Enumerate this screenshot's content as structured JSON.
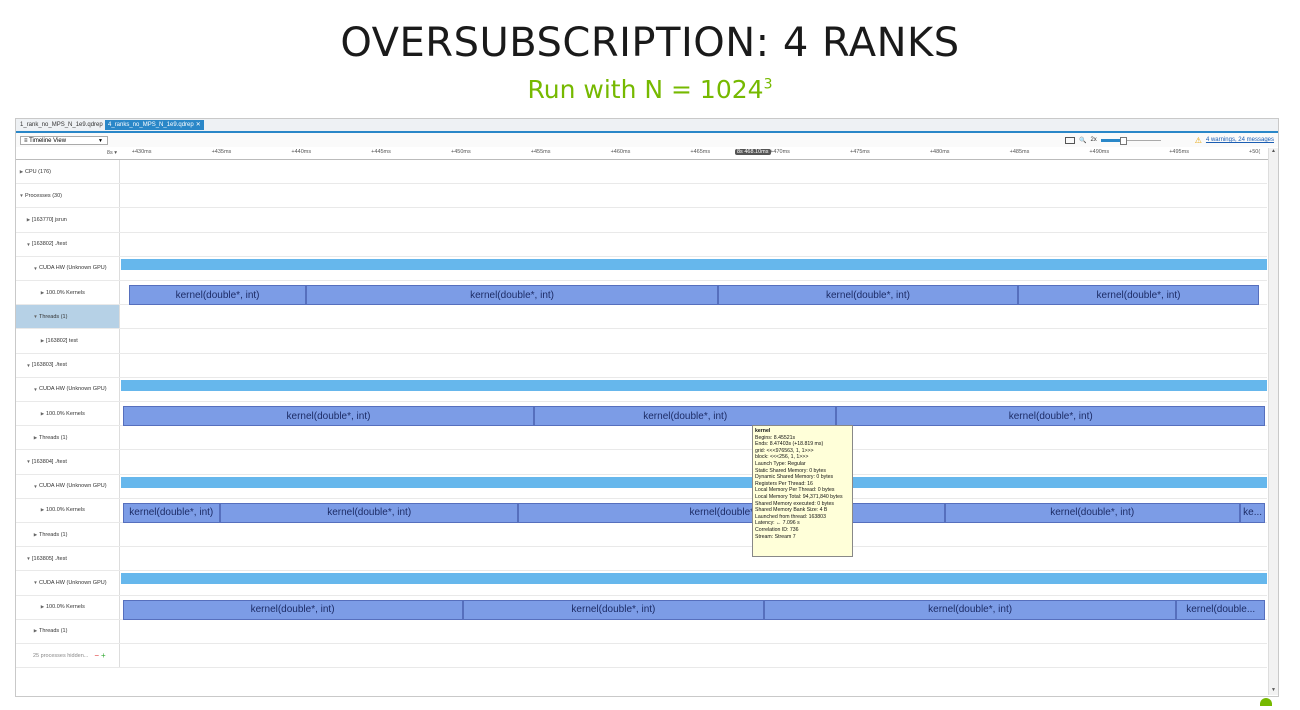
{
  "slide": {
    "title": "OVERSUBSCRIPTION: 4 RANKS",
    "subtitle_prefix": "Run with N = 1024",
    "subtitle_exp": "3"
  },
  "tabs": [
    {
      "label": "1_rank_no_MPS_N_1e9.qdrep"
    },
    {
      "label": "4_ranks_no_MPS_N_1e9.qdrep"
    }
  ],
  "toolbar": {
    "view": "Timeline View",
    "zoom_label": "2x",
    "zoom_level": 0.35,
    "warnings": "4 warnings, 24 messages"
  },
  "ruler": {
    "left": "8s",
    "ticks": [
      "+430ms",
      "+435ms",
      "+440ms",
      "+445ms",
      "+450ms",
      "+455ms",
      "+460ms",
      "+465ms",
      "+470ms",
      "+475ms",
      "+480ms",
      "+485ms",
      "+490ms",
      "+495ms",
      "+50("
    ],
    "cursor": "8s 468.10ms"
  },
  "tree": [
    {
      "label": "CPU (176)",
      "indent": 0,
      "expanded": false
    },
    {
      "label": "Processes (30)",
      "indent": 0,
      "expanded": true
    },
    {
      "label": "[163770] jsrun",
      "indent": 1,
      "expanded": false
    },
    {
      "label": "[163802] ./test",
      "indent": 1,
      "expanded": true
    },
    {
      "label": "CUDA HW (Unknown GPU)",
      "indent": 2,
      "expanded": true
    },
    {
      "label": "100.0% Kernels",
      "indent": 3,
      "expanded": false
    },
    {
      "label": "Threads (1)",
      "indent": 2,
      "expanded": true,
      "selected": true
    },
    {
      "label": "[163802] test",
      "indent": 3,
      "expanded": false
    },
    {
      "label": "[163803] ./test",
      "indent": 1,
      "expanded": true
    },
    {
      "label": "CUDA HW (Unknown GPU)",
      "indent": 2,
      "expanded": true
    },
    {
      "label": "100.0% Kernels",
      "indent": 3,
      "expanded": false
    },
    {
      "label": "Threads (1)",
      "indent": 2,
      "expanded": false
    },
    {
      "label": "[163804] ./test",
      "indent": 1,
      "expanded": true
    },
    {
      "label": "CUDA HW (Unknown GPU)",
      "indent": 2,
      "expanded": true
    },
    {
      "label": "100.0% Kernels",
      "indent": 3,
      "expanded": false
    },
    {
      "label": "Threads (1)",
      "indent": 2,
      "expanded": false
    },
    {
      "label": "[163805] ./test",
      "indent": 1,
      "expanded": true
    },
    {
      "label": "CUDA HW (Unknown GPU)",
      "indent": 2,
      "expanded": true
    },
    {
      "label": "100.0% Kernels",
      "indent": 3,
      "expanded": false
    },
    {
      "label": "Threads (1)",
      "indent": 2,
      "expanded": false
    }
  ],
  "hidden_processes": "25 processes hidden...",
  "kernel_rows": [
    {
      "row": 5,
      "kernels": [
        {
          "start_ms": 429.7,
          "end_ms": 440.8,
          "label": "kernel(double*, int)"
        },
        {
          "start_ms": 440.8,
          "end_ms": 466.6,
          "label": "kernel(double*, int)"
        },
        {
          "start_ms": 466.6,
          "end_ms": 485.4,
          "label": "kernel(double*, int)"
        },
        {
          "start_ms": 485.4,
          "end_ms": 500.5,
          "label": "kernel(double*, int)"
        }
      ]
    },
    {
      "row": 10,
      "kernels": [
        {
          "start_ms": 429.3,
          "end_ms": 455.1,
          "label": "kernel(double*, int)"
        },
        {
          "start_ms": 455.1,
          "end_ms": 474.0,
          "label": "kernel(double*, int)"
        },
        {
          "start_ms": 474.0,
          "end_ms": 500.9,
          "label": "kernel(double*, int)"
        }
      ]
    },
    {
      "row": 14,
      "kernels": [
        {
          "start_ms": 429.3,
          "end_ms": 435.4,
          "label": "kernel(double*, int)"
        },
        {
          "start_ms": 435.4,
          "end_ms": 454.1,
          "label": "kernel(double*, int)"
        },
        {
          "start_ms": 454.1,
          "end_ms": 480.8,
          "label": "kernel(double*, int)"
        },
        {
          "start_ms": 480.8,
          "end_ms": 499.3,
          "label": "kernel(double*, int)"
        },
        {
          "start_ms": 499.3,
          "end_ms": 500.9,
          "label": "ke..."
        }
      ]
    },
    {
      "row": 18,
      "kernels": [
        {
          "start_ms": 429.3,
          "end_ms": 450.6,
          "label": "kernel(double*, int)"
        },
        {
          "start_ms": 450.6,
          "end_ms": 469.5,
          "label": "kernel(double*, int)"
        },
        {
          "start_ms": 469.5,
          "end_ms": 495.3,
          "label": "kernel(double*, int)"
        },
        {
          "start_ms": 495.3,
          "end_ms": 500.9,
          "label": "kernel(double..."
        }
      ]
    }
  ],
  "gpu_rows": [
    4,
    9,
    13,
    17
  ],
  "tooltip": {
    "lines": [
      "kernel",
      "Begins: 8.45521s",
      "Ends: 8.47403s (+18.819 ms)",
      "grid:  <<<976563, 1, 1>>>",
      "block: <<<256, 1, 1>>>",
      "Launch Type: Regular",
      "Static Shared Memory: 0 bytes",
      "Dynamic Shared Memory: 0 bytes",
      "Registers Per Thread: 16",
      "Local Memory Per Thread: 0 bytes",
      "Local Memory Total: 94,371,840 bytes",
      "Shared Memory executed: 0 bytes",
      "Shared Memory Bank Size: 4 B",
      "Launched from thread: 163803",
      "Latency: ← 7.096 s",
      "Correlation ID: 736",
      "Stream: Stream 7"
    ]
  },
  "colors": {
    "kernel": "#7c9ce6",
    "gpu_bar": "#66b7ec",
    "accent": "#2a87c8",
    "subtitle": "#76b900"
  }
}
